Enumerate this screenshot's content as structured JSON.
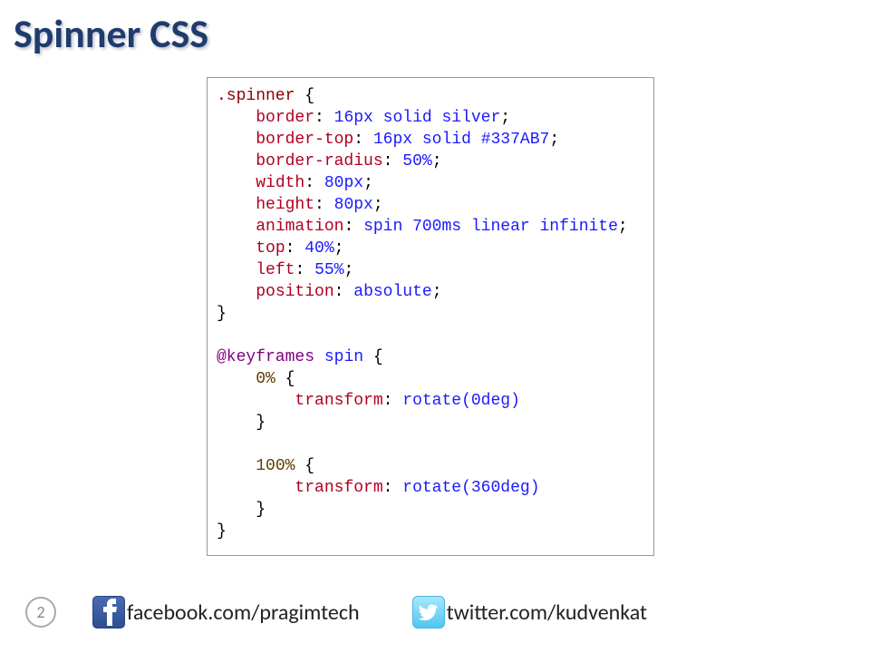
{
  "title": "Spinner CSS",
  "code": {
    "selector": ".spinner",
    "rules": [
      {
        "prop": "border",
        "val": "16px solid silver"
      },
      {
        "prop": "border-top",
        "val": "16px solid #337AB7"
      },
      {
        "prop": "border-radius",
        "val": "50%"
      },
      {
        "prop": "width",
        "val": "80px"
      },
      {
        "prop": "height",
        "val": "80px"
      },
      {
        "prop": "animation",
        "val": "spin 700ms linear infinite"
      },
      {
        "prop": "top",
        "val": "40%"
      },
      {
        "prop": "left",
        "val": "55%"
      },
      {
        "prop": "position",
        "val": "absolute"
      }
    ],
    "keyframes": {
      "keyword": "@keyframes",
      "name": "spin",
      "frames": [
        {
          "pct": "0%",
          "prop": "transform",
          "val": "rotate(0deg)"
        },
        {
          "pct": "100%",
          "prop": "transform",
          "val": "rotate(360deg)"
        }
      ]
    }
  },
  "footer": {
    "page": "2",
    "facebook": "facebook.com/pragimtech",
    "twitter": "twitter.com/kudvenkat"
  }
}
